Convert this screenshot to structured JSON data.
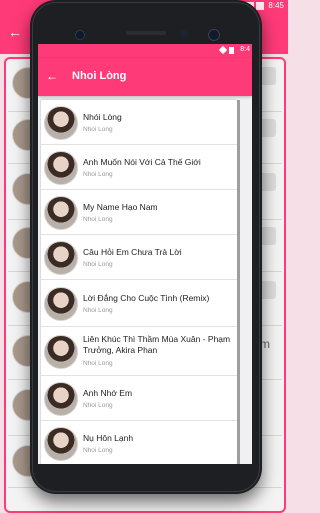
{
  "background_app": {
    "time": "8:45",
    "accent": "#ff3a78",
    "partial_text": "m"
  },
  "status_bar": {
    "time": "8:4"
  },
  "toolbar": {
    "title": "Nhoi Lòng",
    "back_icon": "arrow-left-icon"
  },
  "songs": [
    {
      "title": "Nhói Lòng",
      "artist": "Nhoi Long"
    },
    {
      "title": "Anh Muốn Nói Với Cả Thế Giới",
      "artist": "Nhoi Long"
    },
    {
      "title": "My Name Hạo Nam",
      "artist": "Nhoi Long"
    },
    {
      "title": "Câu Hỏi Em Chưa Trả Lời",
      "artist": "Nhoi Long"
    },
    {
      "title": "Lời Đắng Cho Cuộc Tình (Remix)",
      "artist": "Nhoi Long"
    },
    {
      "title": "Liên Khúc Thì Thầm Mùa Xuân - Phạm Trưởng, Akira Phan",
      "artist": "Nhoi Long"
    },
    {
      "title": "Anh Nhớ Em",
      "artist": "Nhoi Long"
    },
    {
      "title": "Nụ Hôn Lạnh",
      "artist": "Nhoi Long"
    }
  ]
}
